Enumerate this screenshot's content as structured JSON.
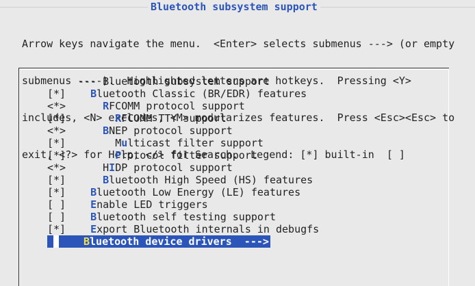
{
  "window": {
    "title_hot": "B",
    "title_rest": "luetooth subsystem support"
  },
  "help": {
    "lines": [
      "Arrow keys navigate the menu.  <Enter> selects submenus ---> (or empty",
      "submenus ----).  Highlighted letters are hotkeys.  Pressing <Y>",
      "includes, <N> excludes, <M> modularizes features.  Press <Esc><Esc> to",
      "exit, <?> for Help, </> for Search.  Legend: [*] built-in  [ ]"
    ]
  },
  "menu": {
    "items": [
      {
        "mark": "",
        "indent": "--- ",
        "hot": "",
        "rest": "Bluetooth subsystem support"
      },
      {
        "mark": "[*]",
        "indent": "  ",
        "hot": "B",
        "rest": "luetooth Classic (BR/EDR) features"
      },
      {
        "mark": "<*>",
        "indent": "    ",
        "hot": "R",
        "rest": "FCOMM protocol support"
      },
      {
        "mark": "[*]",
        "indent": "      ",
        "hot": "R",
        "rest": "FCOMM TTY support"
      },
      {
        "mark": "<*>",
        "indent": "    ",
        "hot": "B",
        "rest": "NEP protocol support"
      },
      {
        "mark": "[*]",
        "indent": "      ",
        "pre": "M",
        "hot": "u",
        "rest": "lticast filter support"
      },
      {
        "mark": "[*]",
        "indent": "      ",
        "hot": "P",
        "rest": "rotocol filter support"
      },
      {
        "mark": "<*>",
        "indent": "    ",
        "pre": "H",
        "hot": "I",
        "rest": "DP protocol support"
      },
      {
        "mark": "[*]",
        "indent": "    ",
        "hot": "B",
        "rest": "luetooth High Speed (HS) features"
      },
      {
        "mark": "[*]",
        "indent": "  ",
        "hot": "B",
        "rest": "luetooth Low Energy (LE) features"
      },
      {
        "mark": "[ ]",
        "indent": "  ",
        "hot": "E",
        "rest": "nable LED triggers"
      },
      {
        "mark": "[ ]",
        "indent": "  ",
        "hot": "B",
        "rest": "luetooth self testing support"
      },
      {
        "mark": "[*]",
        "indent": "  ",
        "hot": "E",
        "rest": "xport Bluetooth internals in debugfs"
      }
    ],
    "selected": {
      "hot": "B",
      "rest": "luetooth device drivers  --->"
    }
  },
  "colors": {
    "background": "#e9e9e9",
    "accent": "#2b55b8",
    "hotkey_selected": "#f2e14a"
  }
}
